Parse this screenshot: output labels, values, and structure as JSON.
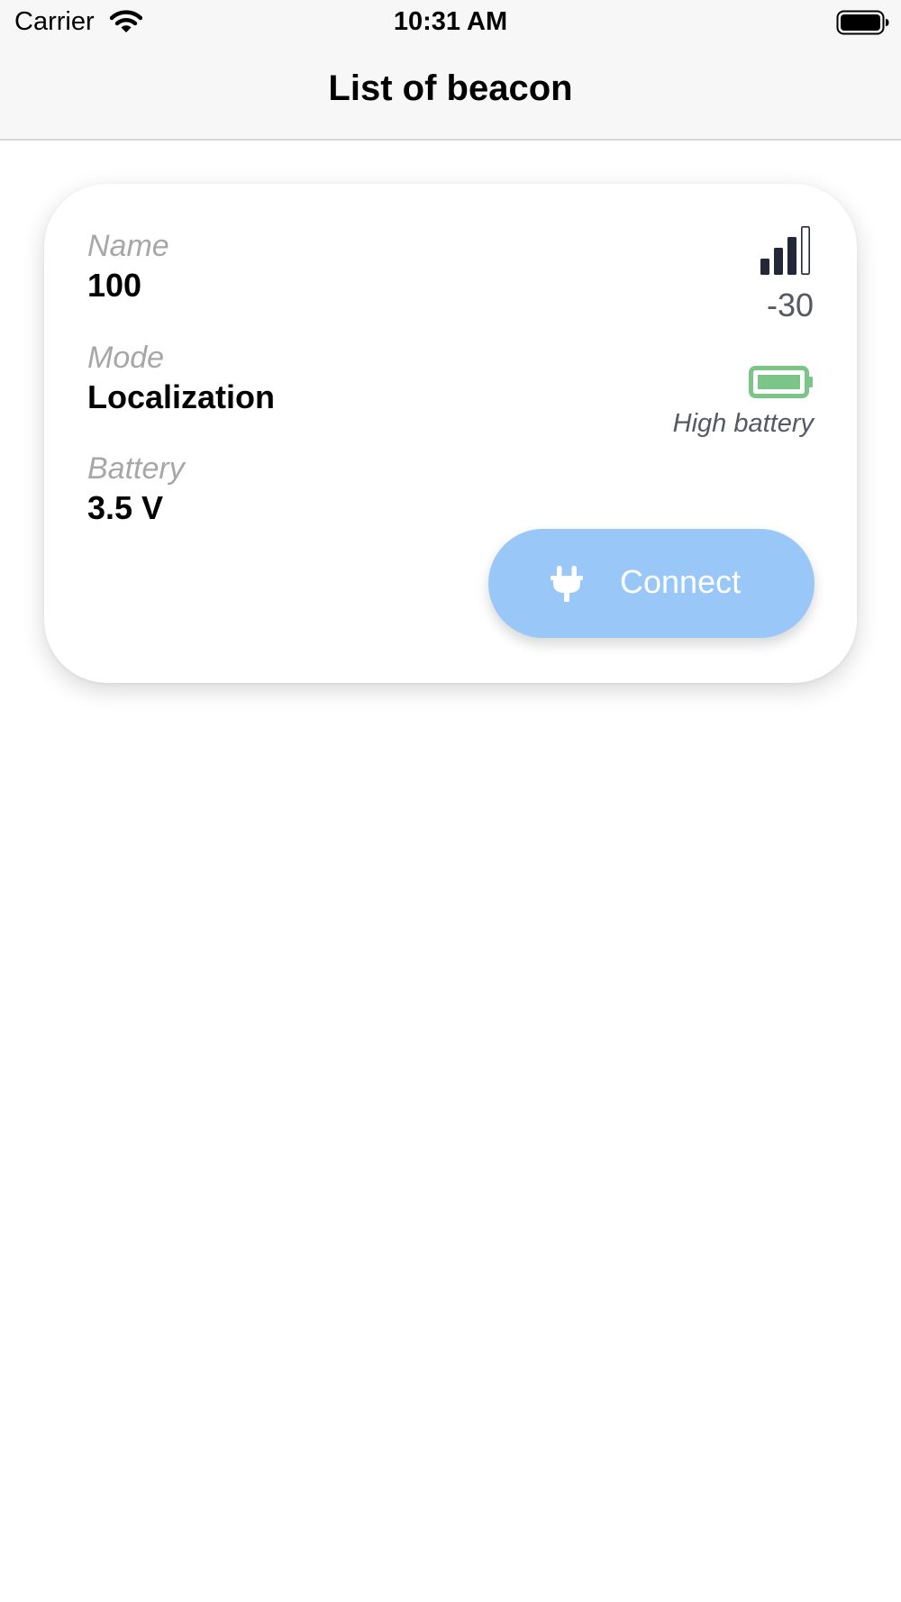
{
  "status_bar": {
    "carrier": "Carrier",
    "time": "10:31 AM",
    "wifi_icon": "wifi-icon",
    "battery_icon": "battery-full-icon"
  },
  "nav": {
    "title": "List of beacon"
  },
  "beacon_card": {
    "name_label": "Name",
    "name_value": "100",
    "mode_label": "Mode",
    "mode_value": "Localization",
    "battery_label": "Battery",
    "battery_value": "3.5 V",
    "signal_icon": "signal-strength-icon",
    "signal_bars_filled": 3,
    "signal_bars_total": 4,
    "rssi": "-30",
    "battery_status_icon": "battery-high-icon",
    "battery_status_color": "#7bc588",
    "battery_status": "High battery",
    "connect_icon": "plug-icon",
    "connect_label": "Connect",
    "connect_button_color": "#99c8f8"
  }
}
